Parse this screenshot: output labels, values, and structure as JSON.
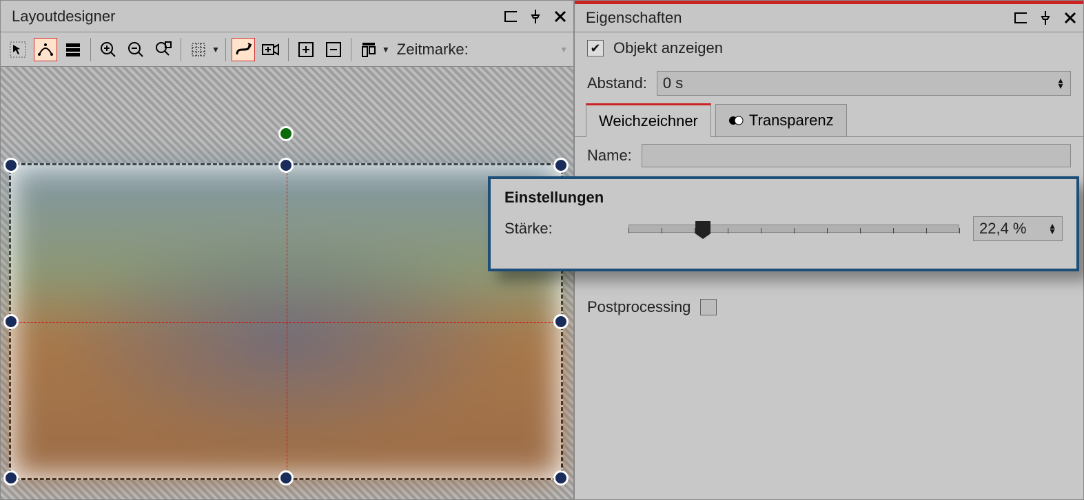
{
  "layout_panel": {
    "title": "Layoutdesigner",
    "timemark_label": "Zeitmarke:"
  },
  "props_panel": {
    "title": "Eigenschaften",
    "show_object_label": "Objekt anzeigen",
    "show_object_checked": true,
    "distance_label": "Abstand:",
    "distance_value": "0 s",
    "tabs": {
      "blur": "Weichzeichner",
      "transparency": "Transparenz"
    },
    "name_label": "Name:",
    "name_value": "",
    "postprocessing_label": "Postprocessing",
    "postprocessing_checked": false
  },
  "settings_popup": {
    "title": "Einstellungen",
    "strength_label": "Stärke:",
    "strength_percent": 22.4,
    "strength_display": "22,4 %"
  }
}
